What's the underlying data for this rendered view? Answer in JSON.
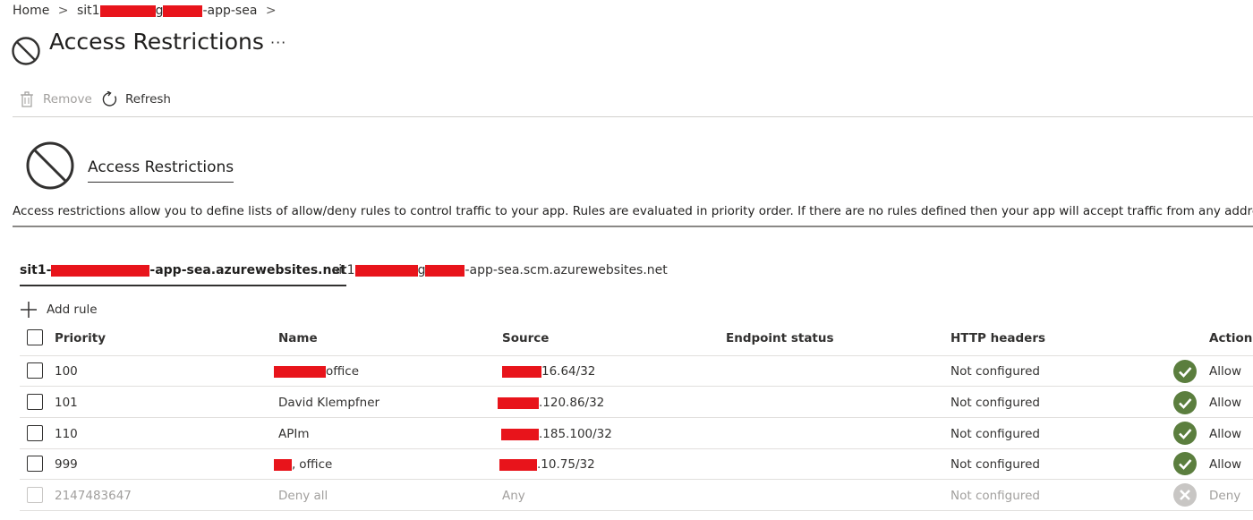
{
  "breadcrumb": {
    "home": "Home",
    "sep1": ">",
    "app_prefix": "sit1",
    "app_middle": "g",
    "app_suffix": "-app-sea",
    "sep2": ">"
  },
  "page": {
    "title": "Access Restrictions",
    "more": "···"
  },
  "toolbar": {
    "remove_label": "Remove",
    "refresh_label": "Refresh"
  },
  "hero": {
    "title": "Access Restrictions",
    "description": "Access restrictions allow you to define lists of allow/deny rules to control traffic to your app. Rules are evaluated in priority order. If there are no rules defined then your app will accept traffic from any address. I"
  },
  "tabs": [
    {
      "prefix": "sit1-",
      "middle": "",
      "suffix": "-app-sea.azurewebsites.net",
      "active": true
    },
    {
      "prefix": "sit1",
      "middle": "g",
      "suffix": "-app-sea.scm.azurewebsites.net",
      "active": false
    }
  ],
  "add_rule_label": "Add rule",
  "columns": {
    "priority": "Priority",
    "name": "Name",
    "source": "Source",
    "endpoint_status": "Endpoint status",
    "http_headers": "HTTP headers",
    "action": "Action"
  },
  "rules": [
    {
      "priority": "100",
      "name": "office",
      "source": "16.64/32",
      "endpoint_status": "",
      "http_headers": "Not configured",
      "action": "Allow",
      "icon": "check-icon"
    },
    {
      "priority": "101",
      "name": "David Klempfner",
      "source": ".120.86/32",
      "endpoint_status": "",
      "http_headers": "Not configured",
      "action": "Allow",
      "icon": "check-icon"
    },
    {
      "priority": "110",
      "name": "APIm",
      "source": ".185.100/32",
      "endpoint_status": "",
      "http_headers": "Not configured",
      "action": "Allow",
      "icon": "check-icon"
    },
    {
      "priority": "999",
      "name": "office",
      "name_prefix": ",",
      "source": ".10.75/32",
      "endpoint_status": "",
      "http_headers": "Not configured",
      "action": "Allow",
      "icon": "check-icon"
    },
    {
      "priority": "2147483647",
      "name": "Deny all",
      "source": "Any",
      "endpoint_status": "",
      "http_headers": "Not configured",
      "action": "Deny",
      "icon": "deny-icon",
      "disabled": true
    }
  ],
  "colors": {
    "allow_green": "#5b7e3e",
    "deny_gray": "#c8c6c4",
    "redaction_red": "#e8141b"
  }
}
